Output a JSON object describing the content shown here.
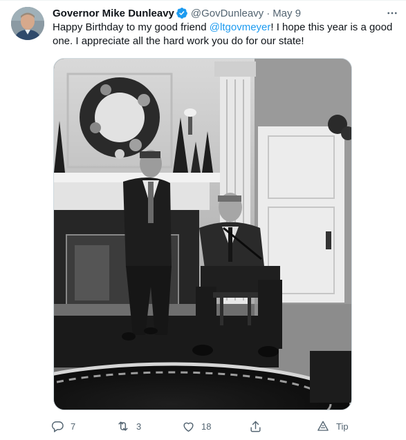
{
  "tweet": {
    "author_name": "Governor Mike Dunleavy",
    "handle": "@GovDunleavy",
    "separator": "·",
    "date": "May 9",
    "text_before": "Happy Birthday to my good friend ",
    "mention": "@ltgovmeyer",
    "text_after": "! I hope this year is a good one. I appreciate all the hard work you do for our state!"
  },
  "actions": {
    "reply_count": "7",
    "retweet_count": "3",
    "like_count": "18",
    "tip_label": "Tip"
  },
  "icons": {
    "verified": "verified-badge-icon",
    "more": "more-icon",
    "reply": "reply-icon",
    "retweet": "retweet-icon",
    "like": "heart-icon",
    "share": "share-icon",
    "tip": "tip-icon"
  },
  "colors": {
    "accent": "#1d9bf0",
    "secondary_text": "#536471",
    "primary_text": "#0f1419"
  }
}
